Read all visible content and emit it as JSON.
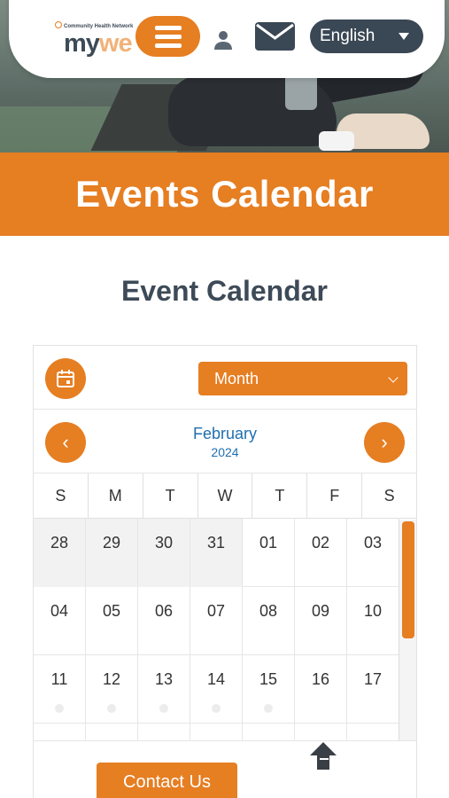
{
  "header": {
    "logo_tagline": "Community Health Network",
    "logo_my": "my",
    "logo_we": "we",
    "language": "English"
  },
  "banner": {
    "title": "Events Calendar"
  },
  "section": {
    "title": "Event Calendar"
  },
  "calendar": {
    "view": "Month",
    "month": "February",
    "year": "2024",
    "prev_symbol": "‹",
    "next_symbol": "›",
    "weekdays": [
      "S",
      "M",
      "T",
      "W",
      "T",
      "F",
      "S"
    ],
    "weeks": [
      [
        "28",
        "29",
        "30",
        "31",
        "01",
        "02",
        "03"
      ],
      [
        "04",
        "05",
        "06",
        "07",
        "08",
        "09",
        "10"
      ],
      [
        "11",
        "12",
        "13",
        "14",
        "15",
        "16",
        "17"
      ]
    ]
  },
  "footer": {
    "contact_label": "Contact Us"
  },
  "colors": {
    "accent": "#e67e22",
    "dark": "#3d4a57",
    "link": "#1e6fb0"
  },
  "icons": [
    "menu-icon",
    "user-icon",
    "mail-icon",
    "calendar-icon",
    "chevron-left-icon",
    "chevron-right-icon",
    "scroll-top-icon"
  ]
}
